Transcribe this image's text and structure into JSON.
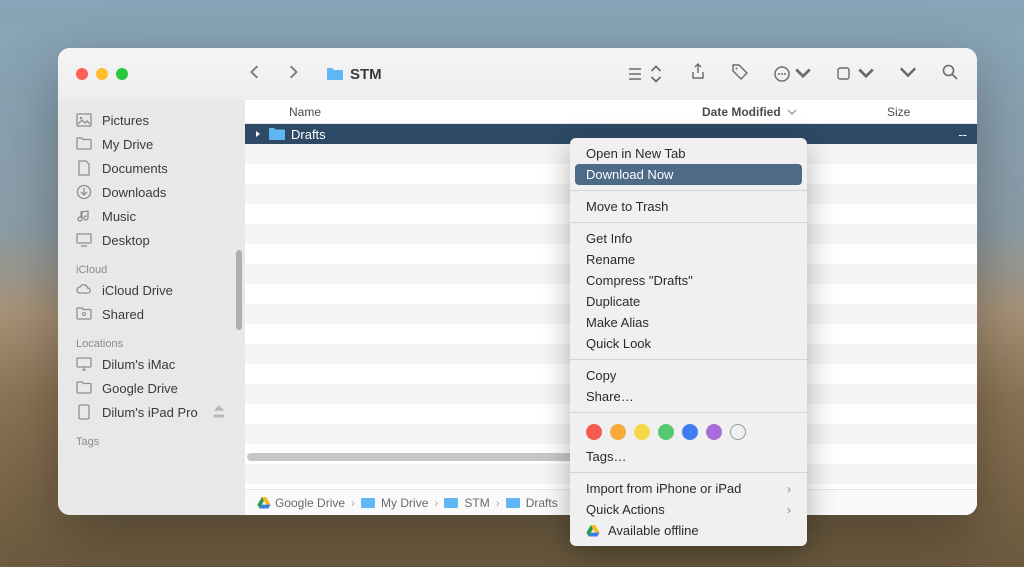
{
  "window": {
    "title": "STM"
  },
  "sidebar": {
    "favorites": [
      {
        "icon": "picture-icon",
        "label": "Pictures"
      },
      {
        "icon": "folder-icon",
        "label": "My Drive"
      },
      {
        "icon": "document-icon",
        "label": "Documents"
      },
      {
        "icon": "download-icon",
        "label": "Downloads"
      },
      {
        "icon": "music-icon",
        "label": "Music"
      },
      {
        "icon": "desktop-icon",
        "label": "Desktop"
      }
    ],
    "sections": [
      {
        "header": "iCloud",
        "items": [
          {
            "icon": "cloud-icon",
            "label": "iCloud Drive"
          },
          {
            "icon": "shared-icon",
            "label": "Shared"
          }
        ]
      },
      {
        "header": "Locations",
        "items": [
          {
            "icon": "imac-icon",
            "label": "Dilum's iMac"
          },
          {
            "icon": "folder-icon",
            "label": "Google Drive"
          },
          {
            "icon": "ipad-icon",
            "label": "Dilum's iPad Pro"
          }
        ]
      },
      {
        "header": "Tags",
        "items": []
      }
    ]
  },
  "columns": {
    "name": "Name",
    "date": "Date Modified",
    "size": "Size"
  },
  "rows": [
    {
      "name": "Drafts",
      "selected": true,
      "date": "--"
    }
  ],
  "pathbar": [
    "Google Drive",
    "My Drive",
    "STM",
    "Drafts"
  ],
  "context_menu": {
    "groups": [
      [
        "Open in New Tab",
        "Download Now"
      ],
      [
        "Move to Trash"
      ],
      [
        "Get Info",
        "Rename",
        "Compress \"Drafts\"",
        "Duplicate",
        "Make Alias",
        "Quick Look"
      ],
      [
        "Copy",
        "Share…"
      ]
    ],
    "highlighted": "Download Now",
    "tag_colors": [
      "#f55a4e",
      "#f7a93b",
      "#f9d74a",
      "#53c971",
      "#3f7ef3",
      "#a96ddb"
    ],
    "tags_label": "Tags…",
    "bottom": [
      {
        "label": "Import from iPhone or iPad",
        "submenu": true
      },
      {
        "label": "Quick Actions",
        "submenu": true
      },
      {
        "label": "Available offline",
        "gdrive": true
      }
    ]
  }
}
